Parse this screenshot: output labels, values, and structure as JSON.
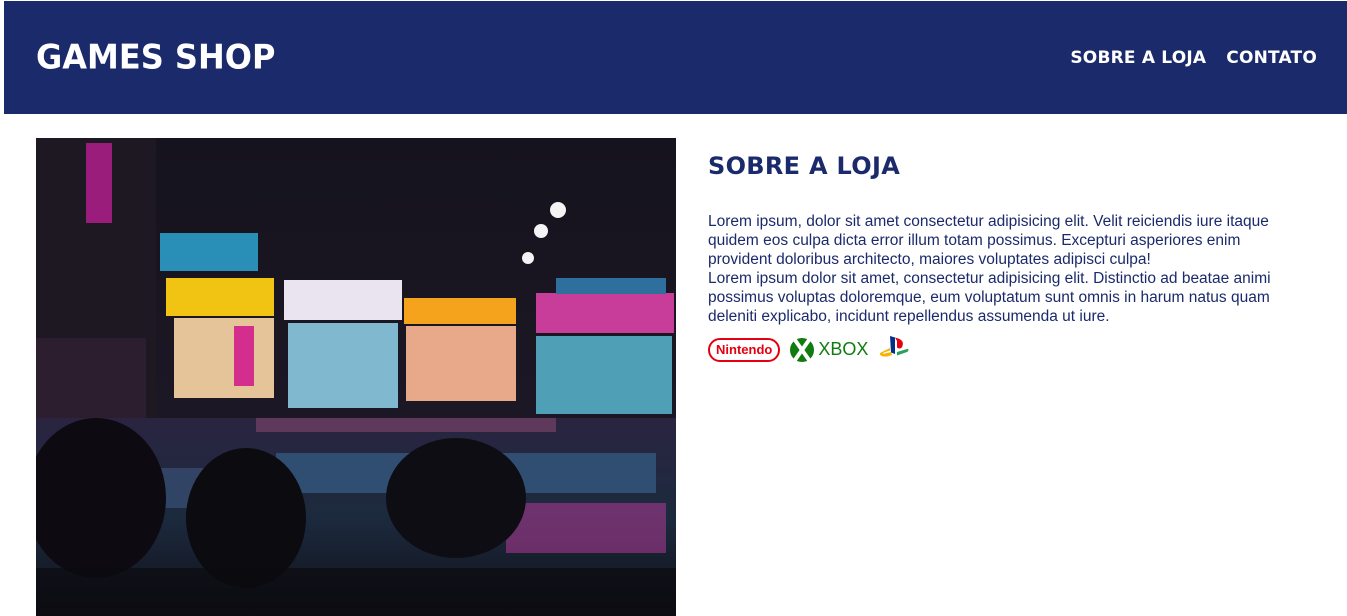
{
  "header": {
    "logo": "GAMES SHOP",
    "nav": [
      "SOBRE A LOJA",
      "CONTATO"
    ]
  },
  "main": {
    "image_alt": "Night street with neon-lit shops",
    "title": "SOBRE A LOJA",
    "paragraph1": "Lorem ipsum, dolor sit amet consectetur adipisicing elit. Velit reiciendis iure itaque quidem eos culpa dicta error illum totam possimus. Excepturi asperiores enim provident doloribus architecto, maiores voluptates adipisci culpa!",
    "paragraph2": "Lorem ipsum dolor sit amet, consectetur adipisicing elit. Distinctio ad beatae animi possimus voluptas doloremque, eum voluptatum sunt omnis in harum natus quam deleniti explicabo, incidunt repellendus assumenda ut iure.",
    "brands": {
      "nintendo": "Nintendo",
      "xbox": "XBOX"
    }
  },
  "colors": {
    "header_bg": "#1b2a6b",
    "accent_text": "#1b2a6b",
    "nintendo_red": "#e4000f",
    "xbox_green": "#107c10"
  }
}
